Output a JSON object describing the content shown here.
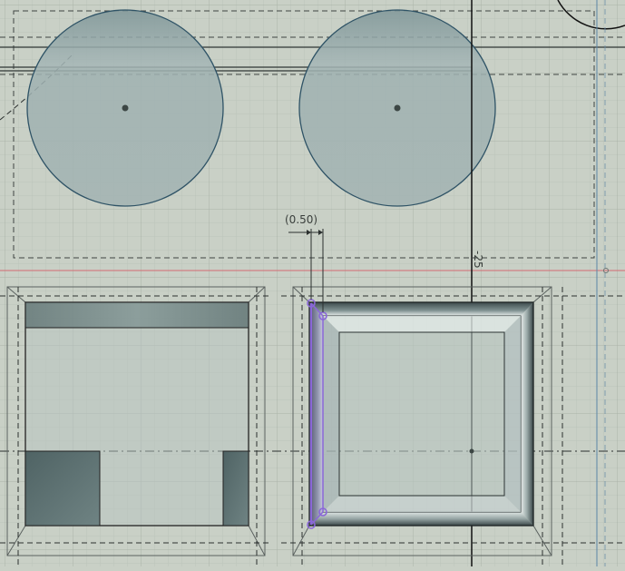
{
  "viewport": {
    "background": "#c9d0c6",
    "grid_color": "#b3bbb1"
  },
  "dimensions": {
    "horizontal_label": "(0.50)",
    "vertical_label": "-25"
  },
  "colors": {
    "sketch_line": "#2f5366",
    "circle_fill": "#8fa3a4",
    "selection": "#8a67d8",
    "axis": "#111111",
    "datum_red": "#d26a72"
  },
  "icons": {
    "dimension": "dimension-arrow-icon",
    "constraint": "constraint-point-icon"
  }
}
